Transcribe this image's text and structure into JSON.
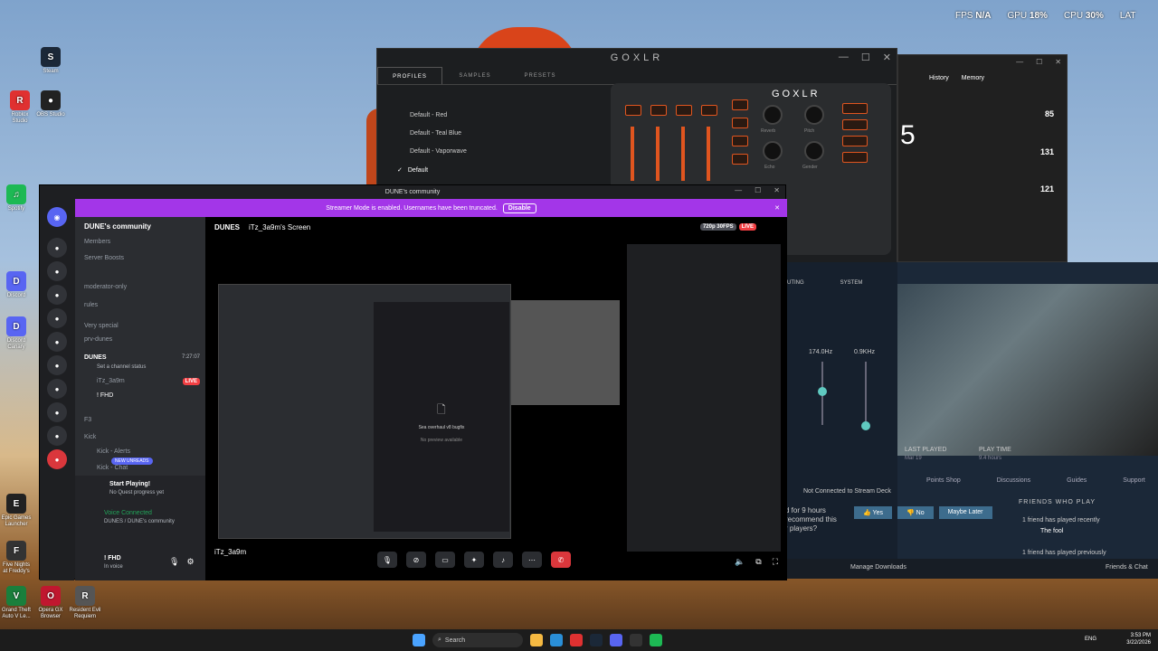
{
  "overlay": {
    "fps_label": "FPS",
    "fps_value": "N/A",
    "gpu_label": "GPU",
    "gpu_value": "18",
    "cpu_label": "CPU",
    "cpu_value": "30",
    "lat_label": "LAT"
  },
  "desktop_icons": [
    {
      "label": "Roblox Studio",
      "color": "#e03131",
      "glyph": "R"
    },
    {
      "label": "OBS Studio",
      "color": "#222",
      "glyph": "●"
    },
    {
      "label": "Discord",
      "color": "#5865f2",
      "glyph": "D"
    },
    {
      "label": "Discord Canary",
      "color": "#5865f2",
      "glyph": "D"
    },
    {
      "label": "Spotify",
      "color": "#1db954",
      "glyph": "♫"
    },
    {
      "label": "Steam",
      "color": "#1b2838",
      "glyph": "S"
    },
    {
      "label": "Epic Games Launcher",
      "color": "#222",
      "glyph": "E"
    },
    {
      "label": "Five Nights at Freddy's",
      "color": "#333",
      "glyph": "F"
    },
    {
      "label": "Grand Theft Auto V Le...",
      "color": "#1a7f3c",
      "glyph": "V"
    },
    {
      "label": "Opera GX Browser",
      "color": "#c0172f",
      "glyph": "O"
    },
    {
      "label": "Resident Evil Requiem",
      "color": "#555",
      "glyph": "R"
    }
  ],
  "goxlr": {
    "title": "GOXLR",
    "tabs": [
      "PROFILES",
      "SAMPLES",
      "PRESETS"
    ],
    "profiles": [
      "Default - Red",
      "Default - Teal Blue",
      "Default - Vaporwave",
      "Default"
    ],
    "knob_labels": [
      "Reverb",
      "Pitch",
      "Echo",
      "Gender"
    ]
  },
  "taskmgr": {
    "tabs": [
      "History",
      "Memory"
    ],
    "big_value": "5",
    "values": [
      "85",
      "131",
      "121"
    ]
  },
  "steam": {
    "tabs": [
      "UTING",
      "SYSTEM"
    ],
    "eq_freqs": [
      "174.0Hz",
      "0.9KHz"
    ],
    "last_played_label": "LAST PLAYED",
    "last_played_value": "Mar 19",
    "play_time_label": "PLAY TIME",
    "play_time_value": "9.4 hours",
    "nav": [
      "Points Shop",
      "Discussions",
      "Guides",
      "Support"
    ],
    "played_for": "d for 9 hours",
    "recommend": "recommend this",
    "players": "r players?",
    "yes": "Yes",
    "no": "No",
    "maybe": "Maybe Later",
    "friends_title": "FRIENDS WHO PLAY",
    "friend_recent": "1 friend has played recently",
    "friend_name": "The fool",
    "friend_previous": "1 friend has played previously",
    "manage_downloads": "Manage Downloads",
    "friends_chat": "Friends & Chat",
    "not_connected": "Not Connected to Stream Deck"
  },
  "discord": {
    "window_title": "DUNE's community",
    "banner_text": "Streamer Mode is enabled. Usernames have been truncated.",
    "banner_button": "Disable",
    "server_name": "DUNE's community",
    "channels": [
      {
        "name": "Members"
      },
      {
        "name": "Server Boosts"
      },
      {
        "name": "moderator-only"
      },
      {
        "name": "rules"
      },
      {
        "name": "Very special"
      },
      {
        "name": "prv-dunes"
      },
      {
        "name": "DUNES"
      },
      {
        "name": "iTz_3a9m"
      },
      {
        "name": "! FHD"
      },
      {
        "name": "F3"
      },
      {
        "name": "Kick"
      },
      {
        "name": "Kick - Alerts"
      },
      {
        "name": "Kick - Chat"
      }
    ],
    "dunes_time": "7:27:07",
    "channel_status": "Set a channel status",
    "new_unreads": "NEW UNREADS",
    "start_playing_title": "Start Playing!",
    "start_playing_sub": "No Quest progress yet",
    "voice_connected": "Voice Connected",
    "voice_sub": "DUNES / DUNE's community",
    "user_name": "! FHD",
    "user_status": "In voice",
    "stream_channel": "DUNES",
    "stream_title": "iTz_3a9m's Screen",
    "quality": "720p 30FPS",
    "live": "LIVE",
    "bottom_user": "iTz_3a9m",
    "preview_text": "Sea overhaul v8 bugfix",
    "preview_sub": "No preview available"
  },
  "taskbar": {
    "search": "Search",
    "lang": "ENG",
    "time": "3:53 PM",
    "date": "3/22/2026"
  }
}
